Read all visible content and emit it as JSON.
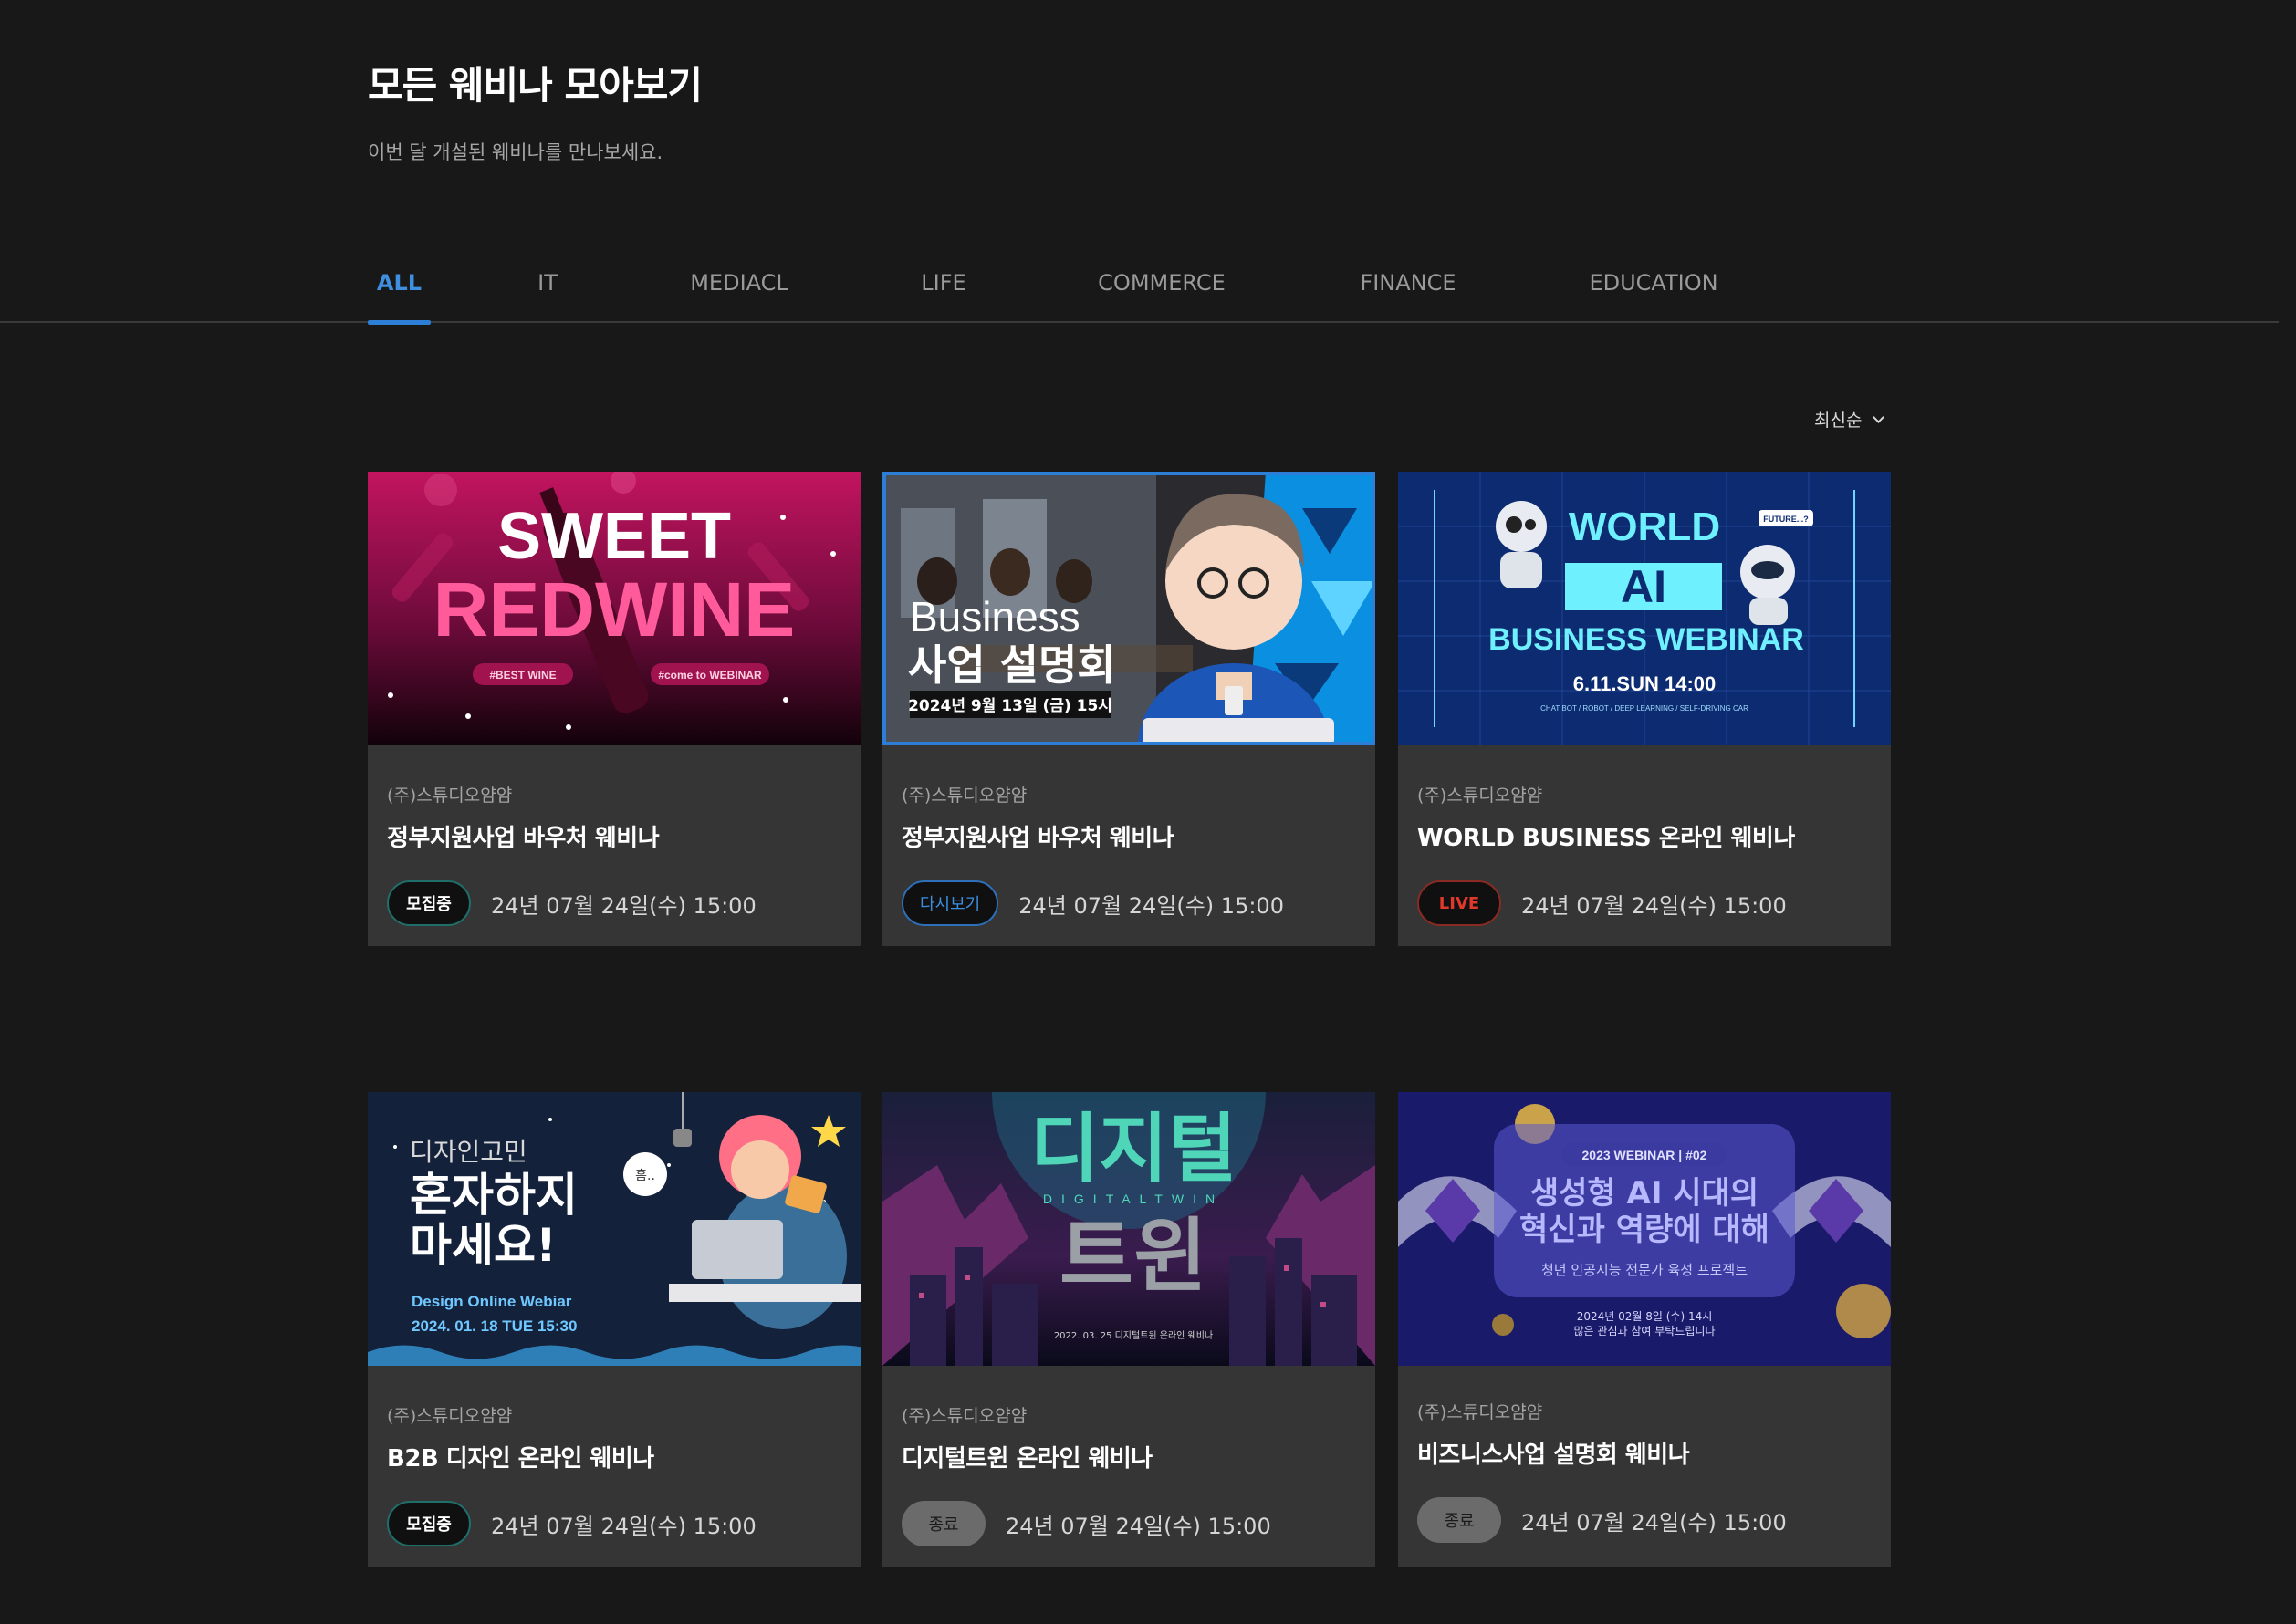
{
  "header": {
    "title": "모든 웨비나 모아보기",
    "subtitle": "이번 달 개설된 웨비나를 만나보세요."
  },
  "tabs": [
    {
      "label": "ALL",
      "active": true
    },
    {
      "label": "IT",
      "active": false
    },
    {
      "label": "MEDIACL",
      "active": false
    },
    {
      "label": "LIFE",
      "active": false
    },
    {
      "label": "COMMERCE",
      "active": false
    },
    {
      "label": "FINANCE",
      "active": false
    },
    {
      "label": "EDUCATION",
      "active": false
    }
  ],
  "sort": {
    "label": "최신순",
    "icon": "chevron-down-icon"
  },
  "colors": {
    "accent": "#2d7ed6",
    "live": "#e0392b",
    "background": "#181818",
    "card": "#353535"
  },
  "cards": [
    {
      "company": "(주)스튜디오얌얌",
      "title": "정부지원사업 바우처 웨비나",
      "badge": "모집중",
      "date": "24년 07월 24일(수) 15:00",
      "thumb": {
        "line1": "SWEET",
        "line2": "REDWINE",
        "tag1": "#BEST WINE",
        "tag2": "#come to WEBINAR"
      }
    },
    {
      "company": "(주)스튜디오얌얌",
      "title": "정부지원사업 바우처 웨비나",
      "badge": "다시보기",
      "date": "24년 07월 24일(수) 15:00",
      "thumb": {
        "line1": "Business",
        "line2": "사업 설명회",
        "line3": "2024년 9월 13일 (금) 15시"
      }
    },
    {
      "company": "(주)스튜디오얌얌",
      "title": "WORLD BUSINESS 온라인 웨비나",
      "badge": "LIVE",
      "date": "24년 07월 24일(수) 15:00",
      "thumb": {
        "line1": "WORLD",
        "line2": "AI",
        "line3": "BUSINESS WEBINAR",
        "line4": "6.11.SUN 14:00",
        "line5": "CHAT BOT / ROBOT / DEEP LEARNING / SELF-DRIVING CAR",
        "bubble": "FUTURE...?"
      }
    },
    {
      "company": "(주)스튜디오얌얌",
      "title": "B2B 디자인 온라인 웨비나",
      "badge": "모집중",
      "date": "24년 07월 24일(수) 15:00",
      "thumb": {
        "line1": "디자인고민",
        "line2": "혼자하지",
        "line3": "마세요!",
        "line4": "Design Online Webiar",
        "line5": "2024. 01. 18 TUE 15:30",
        "bubble": "흠.."
      }
    },
    {
      "company": "(주)스튜디오얌얌",
      "title": "디지털트윈 온라인 웨비나",
      "badge": "종료",
      "date": "24년 07월 24일(수) 15:00",
      "thumb": {
        "line1": "디지털",
        "line2": "DIGITALTWIN",
        "line3": "트윈",
        "line4": "2022. 03. 25 디지털트윈 온라인 웨비나"
      }
    },
    {
      "company": "(주)스튜디오얌얌",
      "title": "비즈니스사업 설명회 웨비나",
      "badge": "종료",
      "date": "24년 07월 24일(수) 15:00",
      "thumb": {
        "line1": "2023 WEBINAR | #02",
        "line2": "생성형 AI 시대의",
        "line3": "혁신과 역량에 대해",
        "line4": "청년 인공지능 전문가 육성 프로젝트",
        "line5": "2024년 02월 8일 (수) 14시",
        "line6": "많은 관심과 참여 부탁드립니다"
      }
    }
  ]
}
